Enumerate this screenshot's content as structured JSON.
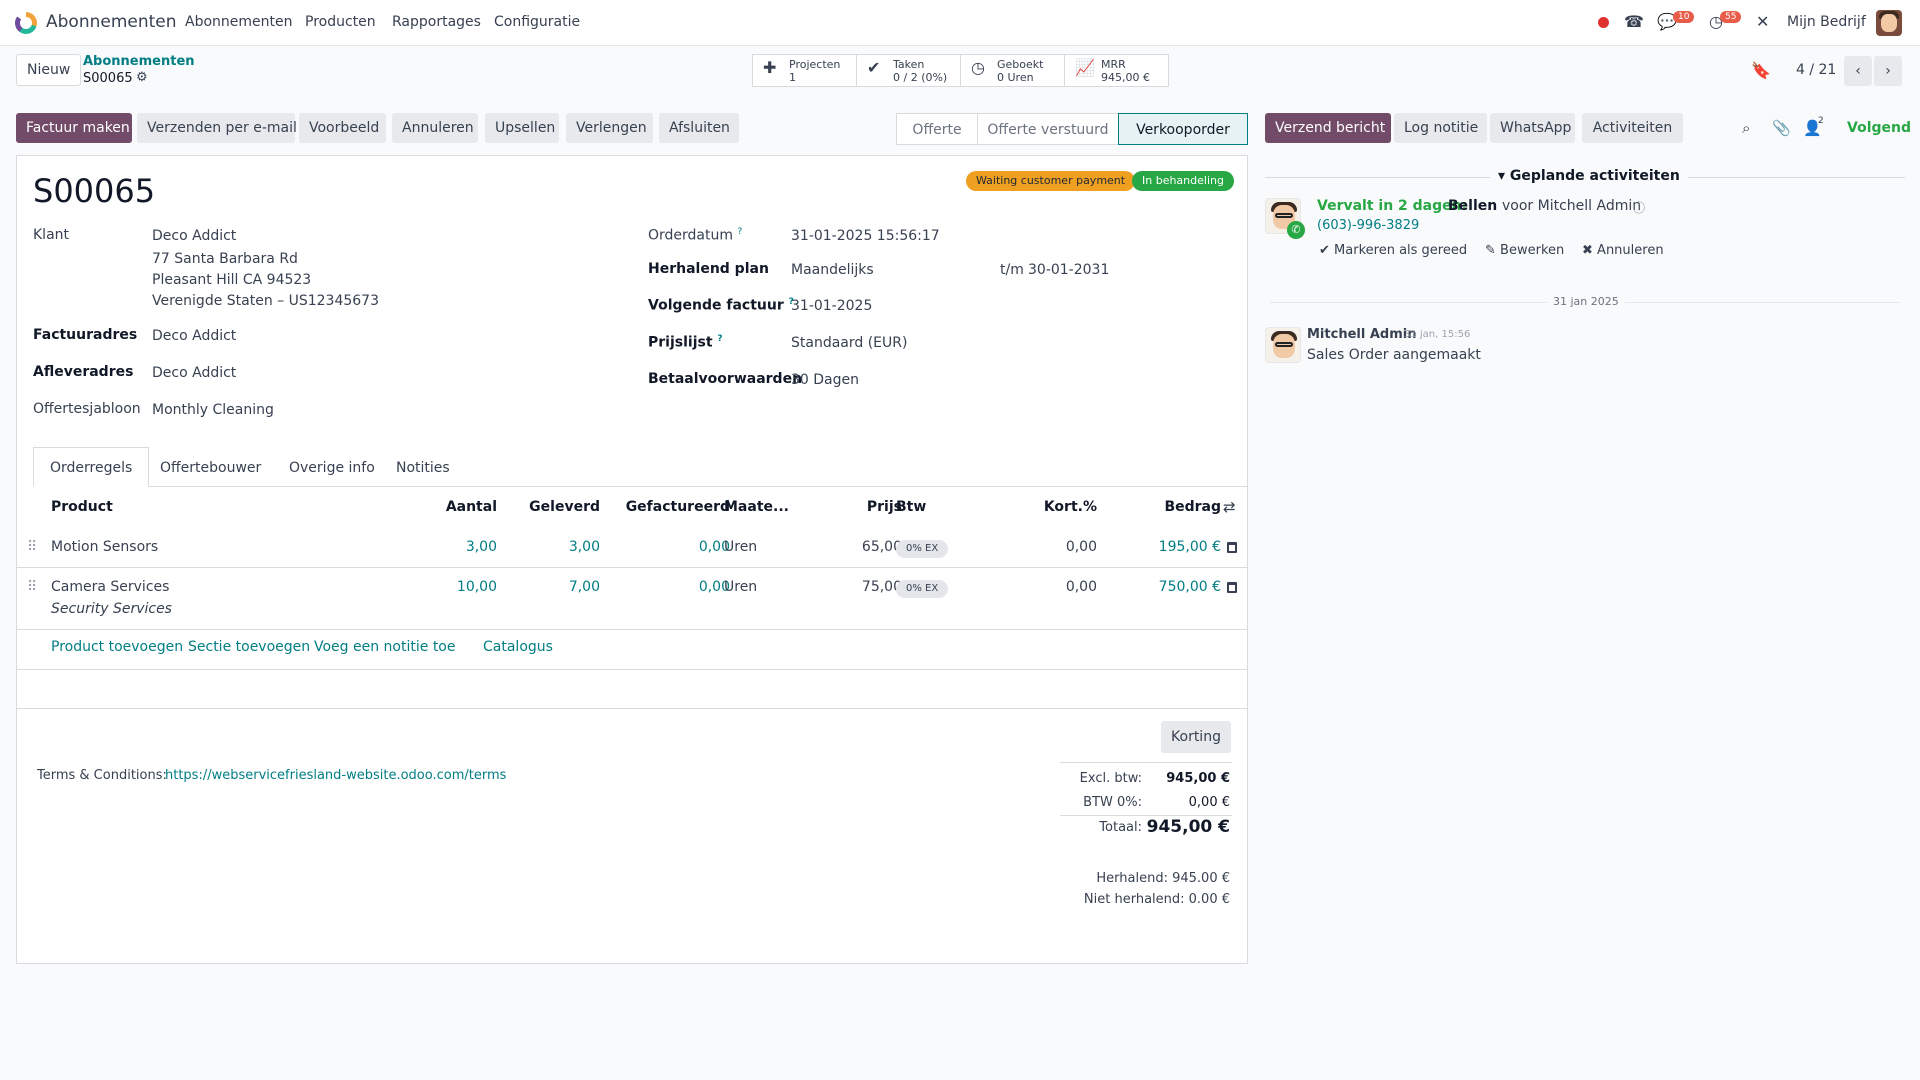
{
  "nav": {
    "app_title": "Abonnementen",
    "menu": [
      "Abonnementen",
      "Producten",
      "Rapportages",
      "Configuratie"
    ],
    "chat_count": "10",
    "activity_count": "55",
    "company": "Mijn Bedrijf"
  },
  "control": {
    "new_button": "Nieuw",
    "breadcrumb_parent": "Abonnementen",
    "breadcrumb_current": "S00065",
    "pager": "4 / 21",
    "smart_buttons": [
      {
        "title": "Projecten",
        "value": "1",
        "icon": "puzzle-icon"
      },
      {
        "title": "Taken",
        "value": "0 / 2 (0%)",
        "icon": "check-icon"
      },
      {
        "title": "Geboekt",
        "value": "0 Uren",
        "icon": "clock-icon"
      },
      {
        "title": "MRR",
        "value": "945,00 €",
        "icon": "line-chart-icon"
      }
    ]
  },
  "actions": [
    "Factuur maken",
    "Verzenden per e-mail",
    "Voorbeeld",
    "Annuleren",
    "Upsellen",
    "Verlengen",
    "Afsluiten"
  ],
  "stages": [
    "Offerte",
    "Offerte verstuurd",
    "Verkooporder"
  ],
  "chatter_actions": {
    "send_message": "Verzend bericht",
    "log_note": "Log notitie",
    "whatsapp": "WhatsApp",
    "activities": "Activiteiten",
    "followers_count": "2",
    "follow": "Volgend"
  },
  "form": {
    "name": "S00065",
    "badge_payment": "Waiting customer payment",
    "badge_state": "In behandeling",
    "customer_label": "Klant",
    "customer_name": "Deco Addict",
    "address_line1": "77 Santa Barbara Rd",
    "address_line2": "Pleasant Hill CA 94523",
    "address_line3": "Verenigde Staten – US12345673",
    "invoice_addr_label": "Factuuradres",
    "invoice_addr": "Deco Addict",
    "delivery_addr_label": "Afleveradres",
    "delivery_addr": "Deco Addict",
    "template_label": "Offertesjabloon",
    "template": "Monthly Cleaning",
    "order_date_label": "Orderdatum",
    "order_date": "31-01-2025 15:56:17",
    "plan_label": "Herhalend plan",
    "plan": "Maandelijks",
    "plan_until": "t/m",
    "plan_end": "30-01-2031",
    "next_invoice_label": "Volgende factuur",
    "next_invoice": "31-01-2025",
    "pricelist_label": "Prijslijst",
    "pricelist": "Standaard (EUR)",
    "payment_terms_label": "Betaalvoorwaarden",
    "payment_terms": "30 Dagen",
    "help_mark": "?"
  },
  "tabs": [
    "Orderregels",
    "Offertebouwer",
    "Overige info",
    "Notities"
  ],
  "table": {
    "headers": {
      "product": "Product",
      "qty": "Aantal",
      "delivered": "Geleverd",
      "invoiced": "Gefactureerd",
      "uom": "Maate...",
      "price": "Prijs",
      "tax": "Btw",
      "discount": "Kort.%",
      "amount": "Bedrag"
    },
    "rows": [
      {
        "product": "Motion Sensors",
        "description": "",
        "qty": "3,00",
        "delivered": "3,00",
        "invoiced": "0,00",
        "uom": "Uren",
        "price": "65,00",
        "tax": "0% EX",
        "discount": "0,00",
        "amount": "195,00 €"
      },
      {
        "product": "Camera Services",
        "description": "Security Services",
        "qty": "10,00",
        "delivered": "7,00",
        "invoiced": "0,00",
        "uom": "Uren",
        "price": "75,00",
        "tax": "0% EX",
        "discount": "0,00",
        "amount": "750,00 €"
      }
    ],
    "add_product": "Product toevoegen",
    "add_section": "Sectie toevoegen",
    "add_note": "Voeg een notitie toe",
    "catalog": "Catalogus"
  },
  "footer": {
    "discount_button": "Korting",
    "terms_label": "Terms & Conditions:",
    "terms_url": "https://webservicefriesland-website.odoo.com/terms",
    "excl_label": "Excl. btw:",
    "excl": "945,00 €",
    "tax_label": "BTW 0%:",
    "tax": "0,00 €",
    "total_label": "Totaal:",
    "total": "945,00 €",
    "recurring": "Herhalend: 945.00 €",
    "non_recurring": "Niet herhalend: 0.00 €"
  },
  "chatter": {
    "planned_title": "Geplande activiteiten",
    "due": "Vervalt in 2 dagen:",
    "activity": "Bellen",
    "for": "voor Mitchell Admin",
    "phone": "(603)-996-3829",
    "mark_done": "Markeren als gereed",
    "edit": "Bewerken",
    "cancel": "Annuleren",
    "date_sep": "31 jan 2025",
    "author": "Mitchell Admin",
    "time": "31 jan, 15:56",
    "message": "Sales Order aangemaakt"
  },
  "colors": {
    "primary": "#714b67",
    "link": "#017e84",
    "badge_orange": "#f0a020",
    "badge_green": "#28a745"
  }
}
